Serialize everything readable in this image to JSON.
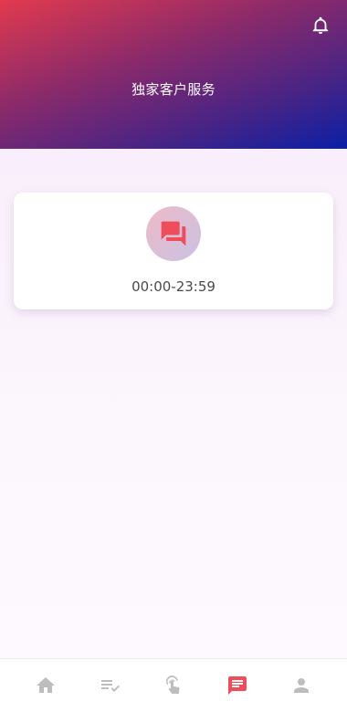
{
  "header": {
    "title": "独家客户服务",
    "bell_icon": "bell-icon"
  },
  "service_card": {
    "icon": "chat-bubbles-icon",
    "hours": "00:00-23:59"
  },
  "tabbar": {
    "items": [
      {
        "icon": "home-icon",
        "active": false
      },
      {
        "icon": "task-list-icon",
        "active": false
      },
      {
        "icon": "tap-gesture-icon",
        "active": false
      },
      {
        "icon": "message-icon",
        "active": true
      },
      {
        "icon": "person-icon",
        "active": false
      }
    ]
  },
  "colors": {
    "header_gradient_start": "#e23a4e",
    "header_gradient_end": "#0a1fa6",
    "accent": "#f04d5a",
    "inactive_icon": "#bdbdbd"
  }
}
